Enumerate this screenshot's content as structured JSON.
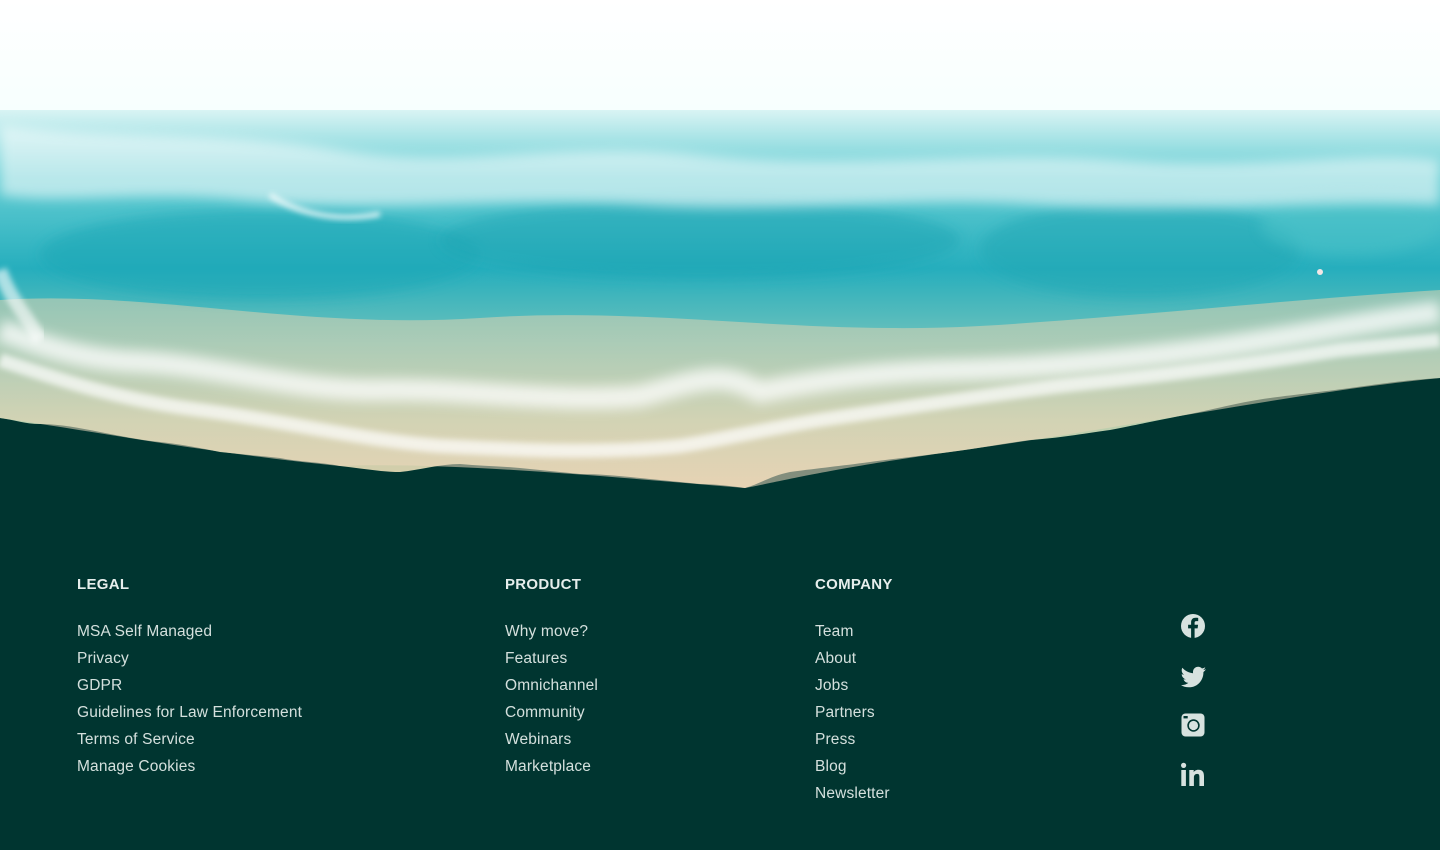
{
  "footer": {
    "columns": [
      {
        "heading": "LEGAL",
        "links": [
          "MSA Self Managed",
          "Privacy",
          "GDPR",
          "Guidelines for Law Enforcement",
          "Terms of Service",
          "Manage Cookies"
        ]
      },
      {
        "heading": "PRODUCT",
        "links": [
          "Why move?",
          "Features",
          "Omnichannel",
          "Community",
          "Webinars",
          "Marketplace"
        ]
      },
      {
        "heading": "COMPANY",
        "links": [
          "Team",
          "About",
          "Jobs",
          "Partners",
          "Press",
          "Blog",
          "Newsletter"
        ]
      }
    ],
    "social": [
      {
        "icon": "facebook-icon"
      },
      {
        "icon": "twitter-icon"
      },
      {
        "icon": "instagram-icon"
      },
      {
        "icon": "linkedin-icon"
      }
    ]
  },
  "colors": {
    "footer_background": "#003530",
    "footer_text": "#d4e0dd",
    "icon_color": "#d7e2df",
    "sea_turquoise": "#2fb6c2",
    "sand": "#e7d6b4"
  }
}
